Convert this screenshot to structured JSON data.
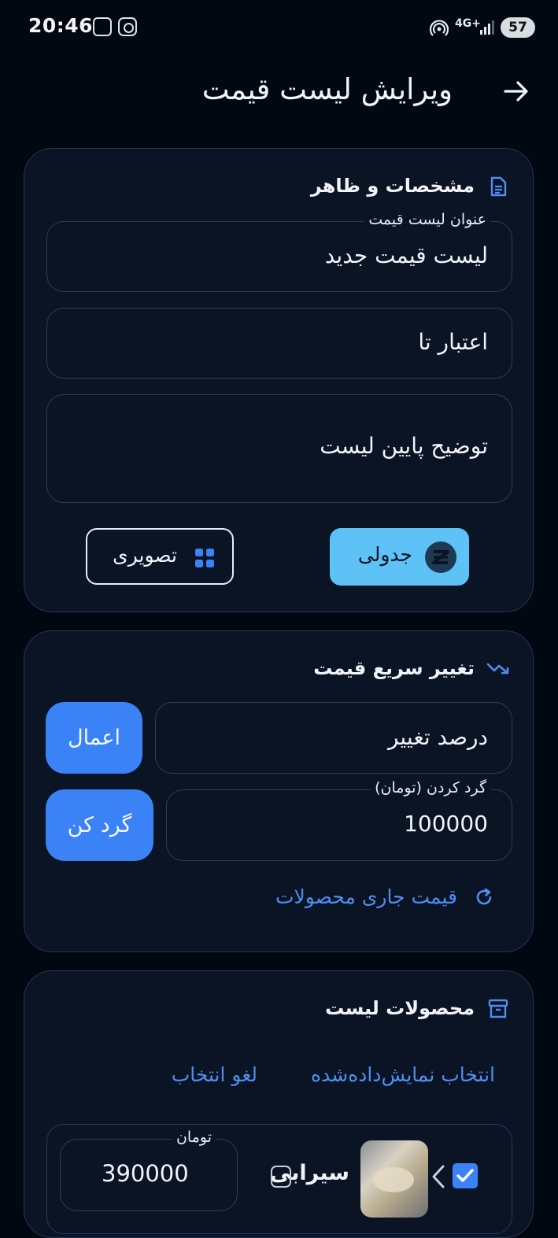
{
  "status_bar": {
    "time": "20:46",
    "network": "4G+",
    "battery": "57"
  },
  "header": {
    "title": "ویرایش لیست قیمت"
  },
  "specs": {
    "title": "مشخصات و ظاهر",
    "title_field": {
      "label": "عنوان لیست قیمت",
      "value": "لیست قیمت جدید"
    },
    "valid_until": {
      "placeholder": "اعتبار تا"
    },
    "footer_desc": {
      "placeholder": "توضیح پایین لیست"
    },
    "layout": {
      "table_label": "جدولی",
      "image_label": "تصویری",
      "selected": "جدولی"
    }
  },
  "quick_change": {
    "title": "تغییر سریع قیمت",
    "percent": {
      "placeholder": "درصد تغییر"
    },
    "apply_label": "اعمال",
    "rounding": {
      "label": "گرد کردن (تومان)",
      "value": "100000"
    },
    "round_button": "گرد کن",
    "current_price_link": "قیمت جاری محصولات"
  },
  "products": {
    "title": "محصولات لیست",
    "select_shown": "انتخاب نمایش‌داده‌شده",
    "deselect": "لغو انتخاب",
    "items": [
      {
        "name": "سیرابی",
        "price_label": "تومان",
        "price": "390000",
        "checked": true
      }
    ]
  },
  "colors": {
    "accent": "#3b82f6",
    "selected_layout": "#5ec2f7",
    "background": "#020812",
    "card": "#0b1424"
  }
}
